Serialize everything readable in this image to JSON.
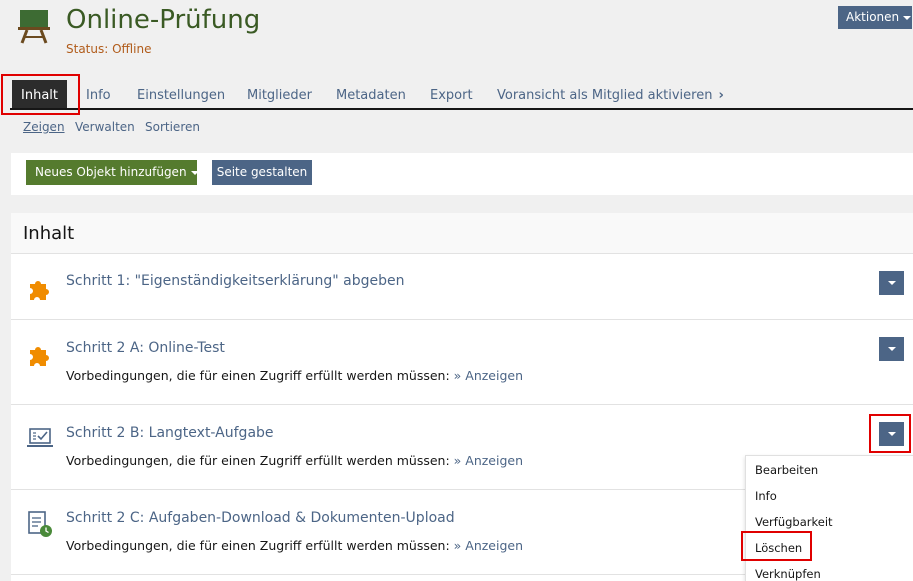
{
  "header": {
    "title": "Online-Prüfung",
    "status": "Status: Offline",
    "actions_label": "Aktionen"
  },
  "tabs": [
    {
      "label": "Inhalt",
      "active": true
    },
    {
      "label": "Info"
    },
    {
      "label": "Einstellungen"
    },
    {
      "label": "Mitglieder"
    },
    {
      "label": "Metadaten"
    },
    {
      "label": "Export"
    },
    {
      "label": "Voransicht als Mitglied aktivieren"
    }
  ],
  "subtabs": [
    {
      "label": "Zeigen",
      "active": true
    },
    {
      "label": "Verwalten"
    },
    {
      "label": "Sortieren"
    }
  ],
  "toolbar": {
    "add_label": "Neues Objekt hinzufügen",
    "design_label": "Seite gestalten"
  },
  "content": {
    "heading": "Inhalt",
    "items": [
      {
        "title": "Schritt 1: \"Eigenständigkeitserklärung\" abgeben",
        "icon": "puzzle-icon"
      },
      {
        "title": "Schritt 2 A: Online-Test",
        "icon": "puzzle-icon",
        "pre_label": "Vorbedingungen, die für einen Zugriff erfüllt werden müssen:",
        "pre_link": "» Anzeigen"
      },
      {
        "title": "Schritt 2 B: Langtext-Aufgabe",
        "icon": "laptop-check-icon",
        "pre_label": "Vorbedingungen, die für einen Zugriff erfüllt werden müssen:",
        "pre_link": "» Anzeigen"
      },
      {
        "title": "Schritt 2 C: Aufgaben-Download & Dokumenten-Upload",
        "icon": "document-clock-icon",
        "pre_label": "Vorbedingungen, die für einen Zugriff erfüllt werden müssen:",
        "pre_link": "» Anzeigen"
      }
    ]
  },
  "dropdown_menu": {
    "items": [
      "Bearbeiten",
      "Info",
      "Verfügbarkeit",
      "Löschen",
      "Verknüpfen"
    ]
  },
  "colors": {
    "accent": "#4c6586",
    "title_green": "#3a5a24",
    "status_orange": "#b15c1b",
    "primary_button": "#557b2e",
    "highlight": "#e00000",
    "puzzle": "#f08c00"
  }
}
